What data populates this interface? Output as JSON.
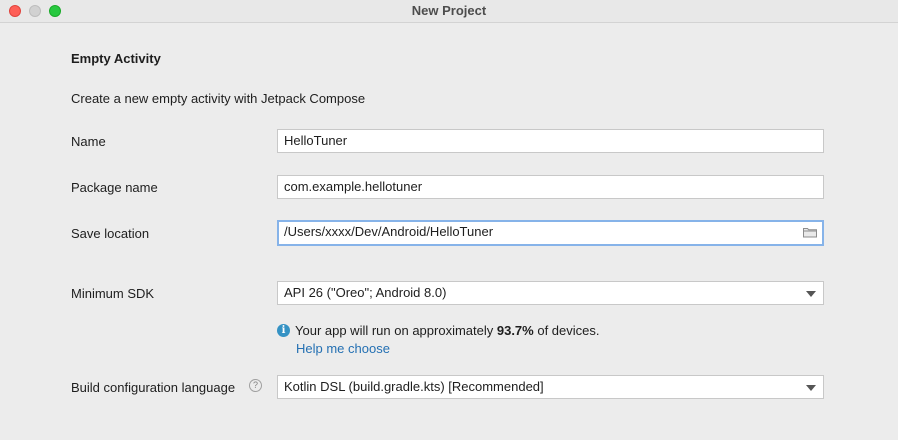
{
  "window": {
    "title": "New Project"
  },
  "form": {
    "heading": "Empty Activity",
    "description": "Create a new empty activity with Jetpack Compose",
    "name": {
      "label": "Name",
      "value": "HelloTuner"
    },
    "package_name": {
      "label": "Package name",
      "value": "com.example.hellotuner"
    },
    "save_location": {
      "label": "Save location",
      "value": "/Users/xxxx/Dev/Android/HelloTuner",
      "icon": "folder-icon"
    },
    "minimum_sdk": {
      "label": "Minimum SDK",
      "selected": "API 26 (\"Oreo\"; Android 8.0)"
    },
    "sdk_info": {
      "prefix": "Your app will run on approximately ",
      "percent": "93.7%",
      "suffix": " of devices.",
      "link": "Help me choose",
      "icon": "info-icon"
    },
    "build_language": {
      "label": "Build configuration language",
      "help_icon": "question-icon",
      "selected": "Kotlin DSL (build.gradle.kts) [Recommended]"
    }
  },
  "colors": {
    "close": "#fe5f57",
    "minimize": "#d1d1d1",
    "maximize": "#28c840",
    "focus_border": "#86b3e9",
    "link": "#2470b3",
    "info": "#3592c4"
  }
}
